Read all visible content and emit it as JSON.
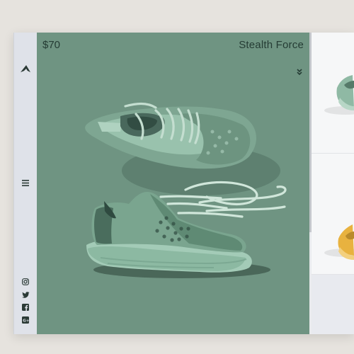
{
  "product": {
    "price": "$70",
    "name": "Stealth Force"
  },
  "sidebar": {
    "logo_icon": "brand-logo-icon",
    "menu_icon": "hamburger-menu-icon",
    "social": [
      "instagram-icon",
      "twitter-icon",
      "facebook-icon",
      "google-plus-icon"
    ]
  },
  "colors": {
    "hero_bg": "#6f9482",
    "sidebar_bg": "#dfe2e9",
    "text_dark": "#253c34",
    "shoe_green": "#8fb9a4",
    "shoe_yellow": "#e8b23f"
  }
}
